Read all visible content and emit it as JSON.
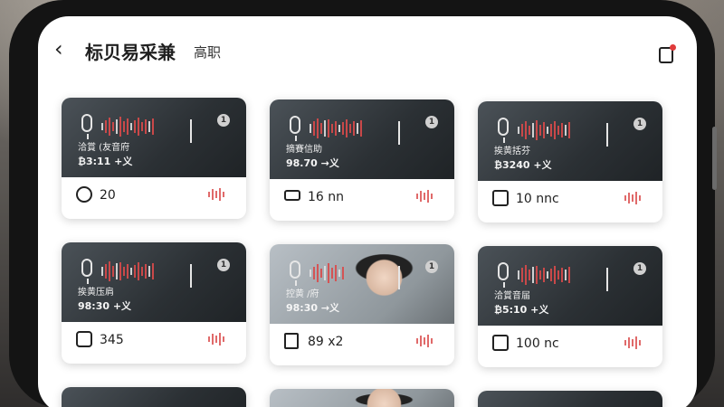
{
  "header": {
    "title": "标贝易采兼",
    "subtitle": "高职",
    "back_icon": "chevron-left-icon",
    "notif_icon": "notification-icon"
  },
  "cards": [
    {
      "thumb_line1": "洽賞 (友音府",
      "thumb_line2": "₿3:11 +义",
      "footer": "20",
      "footer_icon": "smile-icon",
      "thumb_style": "dark"
    },
    {
      "thumb_line1": "摘賽信助",
      "thumb_line2": "98.70 →义",
      "footer": "16 nn",
      "footer_icon": "stack-icon",
      "thumb_style": "dark"
    },
    {
      "thumb_line1": "挨黄括芬",
      "thumb_line2": "₿3240 +义",
      "footer": "10 nnc",
      "footer_icon": "note-icon",
      "thumb_style": "dark"
    },
    {
      "thumb_line1": "挨黄压肩",
      "thumb_line2": "98:30 +义",
      "footer": "345",
      "footer_icon": "square-icon",
      "thumb_style": "dark"
    },
    {
      "thumb_line1": "控黄 /府",
      "thumb_line2": "98:30 →义",
      "footer": "89 x2",
      "footer_icon": "thumbs-icon",
      "thumb_style": "person"
    },
    {
      "thumb_line1": "洽賞音届",
      "thumb_line2": "₿5:10 +义",
      "footer": "100 nc",
      "footer_icon": "share-icon",
      "thumb_style": "dark"
    }
  ]
}
